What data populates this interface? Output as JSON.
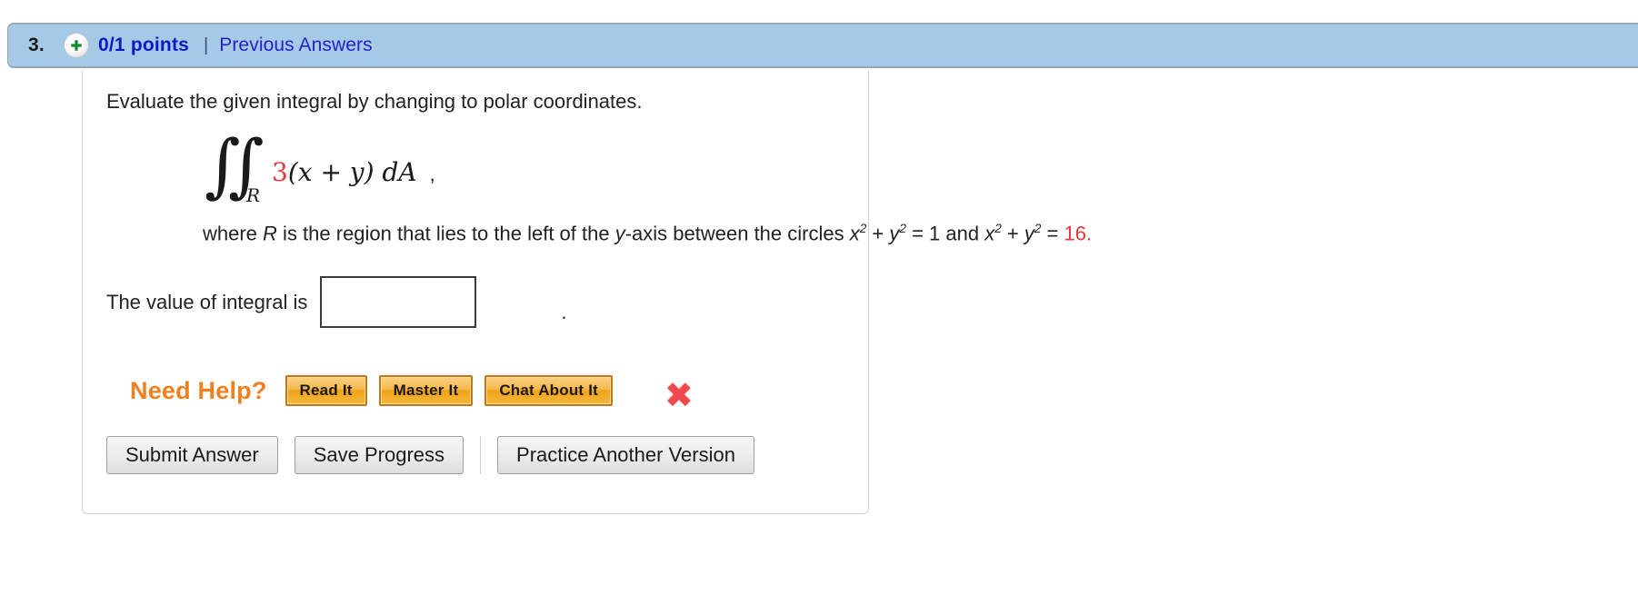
{
  "header": {
    "question_number": "3.",
    "plus_icon": "plus-circle-icon",
    "points": "0/1 points",
    "divider": "|",
    "previous_answers": "Previous Answers",
    "bar_color": "#a6c9e6",
    "points_color": "#0a19c9",
    "link_color": "#2222cc"
  },
  "question": {
    "prompt": "Evaluate the given integral by changing to polar coordinates.",
    "integral": {
      "symbol": "∬",
      "subscript": "R",
      "coefficient": "3",
      "coefficient_color": "#e8383d",
      "integrand": "(x + y) dA",
      "trailing_comma": ","
    },
    "where_line": {
      "prefix": "where ",
      "region_var": "R",
      "middle": " is the region that lies to the left of the ",
      "axis_var": "y",
      "after_axis": "-axis between the circles ",
      "circle1_x": "x",
      "circle1_sup": "2",
      "plus": " + ",
      "circle1_y": "y",
      "equals1": " = 1 and ",
      "circle2_x": "x",
      "circle2_y": "y",
      "equals2": " = ",
      "radius2": "16.",
      "radius2_color": "#e8383d",
      "sup": "2"
    }
  },
  "answer": {
    "label": "The value of integral is",
    "input_value": "",
    "input_placeholder": "",
    "period": ".",
    "result_icon": "red-x-incorrect-icon",
    "result_icon_glyph": "✖",
    "result_icon_color": "#f1474e"
  },
  "need_help": {
    "label": "Need Help?",
    "label_color": "#f08020",
    "buttons": [
      {
        "label": "Read It"
      },
      {
        "label": "Master It"
      },
      {
        "label": "Chat About It"
      }
    ]
  },
  "actions": {
    "submit": "Submit Answer",
    "save": "Save Progress",
    "practice": "Practice Another Version"
  }
}
